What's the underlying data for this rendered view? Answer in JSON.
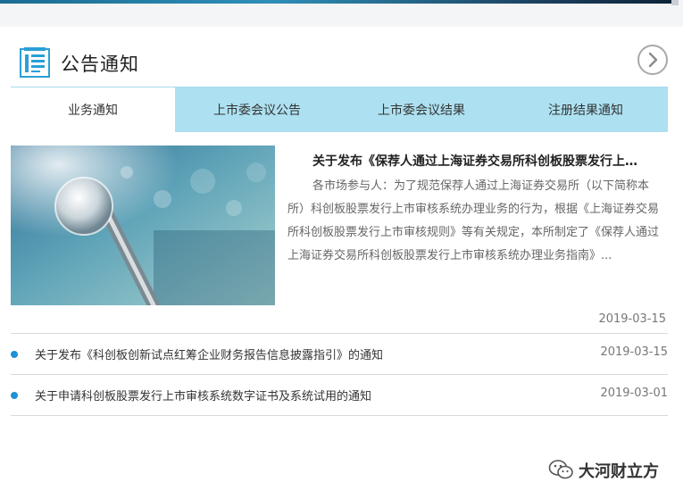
{
  "section": {
    "title": "公告通知"
  },
  "tabs": [
    {
      "label": "业务通知",
      "active": true
    },
    {
      "label": "上市委会议公告",
      "active": false
    },
    {
      "label": "上市委会议结果",
      "active": false
    },
    {
      "label": "注册结果通知",
      "active": false
    }
  ],
  "featured": {
    "title": "关于发布《保荐人通过上海证券交易所科创板股票发行上…",
    "summary": "各市场参与人：为了规范保荐人通过上海证券交易所（以下简称本所）科创板股票发行上市审核系统办理业务的行为，根据《上海证券交易所科创板股票发行上市审核规则》等有关规定，本所制定了《保荐人通过上海证券交易所科创板股票发行上市审核系统办理业务指南》...",
    "date": "2019-03-15"
  },
  "items": [
    {
      "title": "关于发布《科创板创新试点红筹企业财务报告信息披露指引》的通知",
      "date": "2019-03-15"
    },
    {
      "title": "关于申请科创板股票发行上市审核系统数字证书及系统试用的通知",
      "date": "2019-03-01"
    }
  ],
  "watermark": {
    "text": "大河财立方"
  },
  "colors": {
    "tab_bg": "#ade1f1",
    "bullet": "#1e90d6",
    "icon": "#2aa0d6"
  },
  "icons": {
    "section": "newspaper-icon",
    "more": "chevron-right-icon",
    "watermark": "wechat-icon"
  }
}
